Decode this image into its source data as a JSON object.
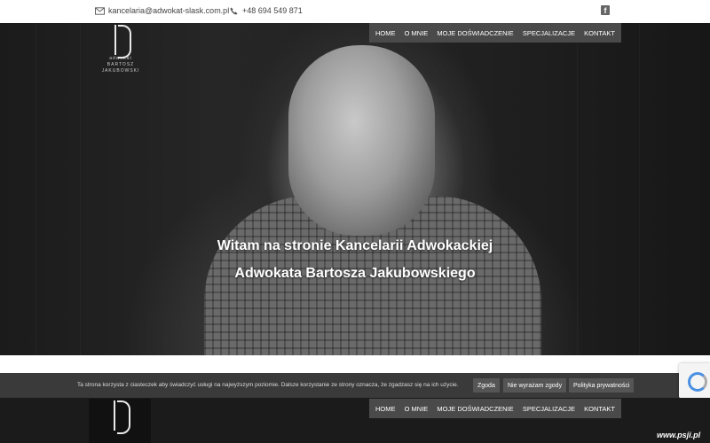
{
  "topbar": {
    "email": "kancelaria@adwokat-slask.com.pl",
    "phone": "+48 694 549 871",
    "email_icon": "envelope-icon",
    "phone_icon": "phone-icon",
    "social_icon": "facebook-icon"
  },
  "logo": {
    "line1": "adwokat",
    "line2": "BARTOSZ JAKUBOWSKI"
  },
  "nav": {
    "items": [
      "HOME",
      "O MNIE",
      "MOJE DOŚWIADCZENIE",
      "SPECJALIZACJE",
      "KONTAKT"
    ]
  },
  "hero": {
    "title_line1": "Witam na stronie Kancelarii Adwokackiej",
    "title_line2": "Adwokata Bartosza Jakubowskiego",
    "slides": 4,
    "active_slide": 1
  },
  "cookie": {
    "text": "Ta strona korzysta z ciasteczek aby świadczyć usługi na najwyższym poziomie. Dalsze korzystanie ze strony oznacza, że zgadzasz się na ich użycie.",
    "accept": "Zgoda",
    "reject": "Nie wyrażam zgody",
    "policy": "Polityka prywatności",
    "close": "✕"
  },
  "watermark": "www.psji.pl",
  "colors": {
    "nav_bg": "#4a4a4a",
    "cookie_bg": "#3a3a3a"
  }
}
